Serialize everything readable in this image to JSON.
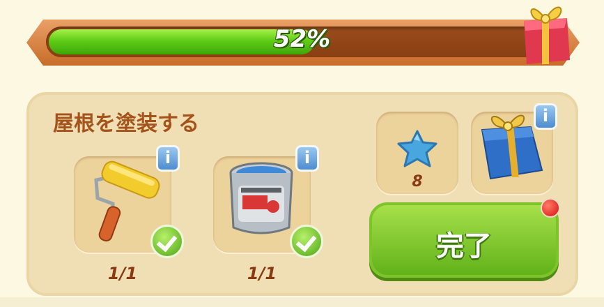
{
  "progress": {
    "percent_label": "52%",
    "fraction": 0.52
  },
  "task": {
    "title": "屋根を塗装する",
    "items": [
      {
        "icon": "paint-roller-icon",
        "count": "1/1",
        "completed": true
      },
      {
        "icon": "paint-can-icon",
        "count": "1/1",
        "completed": true
      }
    ]
  },
  "rewards": {
    "star": {
      "icon": "blue-star-icon",
      "amount": "8"
    },
    "gift": {
      "icon": "blue-gift-box-icon"
    }
  },
  "buttons": {
    "complete_label": "完了",
    "info_label": "i"
  },
  "colors": {
    "progress_fill": "#5fcd16",
    "title_text": "#a4531a",
    "complete_button": "#7dc42a",
    "notification_dot": "#d6120a"
  }
}
